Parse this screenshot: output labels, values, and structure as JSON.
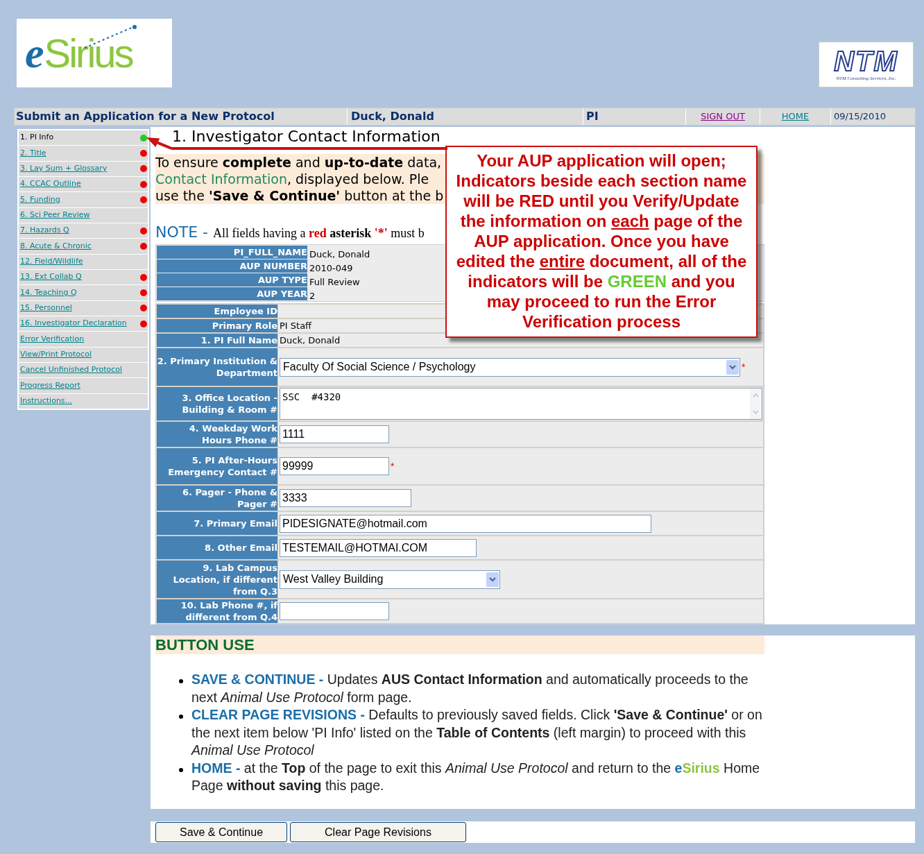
{
  "logo": {
    "letter": "e",
    "word": "Sirius"
  },
  "partner_logo": {
    "mark": "NTM",
    "caption": "NTM Consulting Services, Inc."
  },
  "top_bar": {
    "title": "Submit an Application for a New Protocol",
    "user": "Duck, Donald",
    "role": "PI",
    "sign_out": "SIGN OUT",
    "home": "HOME",
    "date": "09/15/2010"
  },
  "sidebar": {
    "items": [
      {
        "label": "1. PI Info",
        "selected": true,
        "color": "#22cc22"
      },
      {
        "label": "2. Title",
        "selected": false,
        "color": "#ee0000"
      },
      {
        "label": "3. Lay Sum + Glossary",
        "selected": false,
        "color": "#ee0000"
      },
      {
        "label": "4. CCAC Outline",
        "selected": false,
        "color": "#ee0000"
      },
      {
        "label": "5. Funding",
        "selected": false,
        "color": "#ee0000"
      },
      {
        "label": "6. Sci Peer Review",
        "selected": false
      },
      {
        "label": "7. Hazards Q",
        "selected": false,
        "color": "#ee0000"
      },
      {
        "label": "8. Acute & Chronic",
        "selected": false,
        "color": "#ee0000"
      },
      {
        "label": "12. Field/Wildlife",
        "selected": false
      },
      {
        "label": "13. Ext Collab Q",
        "selected": false,
        "color": "#ee0000"
      },
      {
        "label": "14. Teaching Q",
        "selected": false,
        "color": "#ee0000"
      },
      {
        "label": "15. Personnel",
        "selected": false,
        "color": "#ee0000"
      },
      {
        "label": "16. Investigator Declaration",
        "selected": false,
        "color": "#ee0000"
      },
      {
        "label": "Error Verification",
        "selected": false
      },
      {
        "label": "View/Print Protocol",
        "selected": false
      },
      {
        "label": "Cancel Unfinished Protocol",
        "selected": false
      },
      {
        "label": "Progress Report",
        "selected": false
      },
      {
        "label": "Instructions...",
        "selected": false
      }
    ]
  },
  "section_title": "1. Investigator Contact Information",
  "intro_lines": [
    [
      {
        "kind": "plain",
        "text": "To ensure "
      },
      {
        "kind": "bold",
        "text": "complete"
      },
      {
        "kind": "plain",
        "text": " and "
      },
      {
        "kind": "bold",
        "text": "up-to-date"
      },
      {
        "kind": "plain",
        "text": " data,"
      }
    ],
    [
      {
        "kind": "green",
        "text": "Contact Information"
      },
      {
        "kind": "plain",
        "text": ", displayed below. Ple"
      }
    ],
    [
      {
        "kind": "plain",
        "text": "use the "
      },
      {
        "kind": "bold",
        "text": "'Save & Continue'"
      },
      {
        "kind": "plain",
        "text": " button at the b"
      }
    ]
  ],
  "note": {
    "lead": "NOTE -",
    "parts": [
      {
        "kind": "plain",
        "text": "All fields having a "
      },
      {
        "kind": "red",
        "text": "red"
      },
      {
        "kind": "bold",
        "text": " asterisk "
      },
      {
        "kind": "red",
        "text": "'*'"
      },
      {
        "kind": "plain",
        "text": " must b"
      }
    ]
  },
  "summary_rows": [
    {
      "label": "PI_FULL_NAME",
      "value": "Duck, Donald"
    },
    {
      "label": "AUP NUMBER",
      "value": "2010-049"
    },
    {
      "label": "AUP TYPE",
      "value": "Full Review"
    },
    {
      "label": "AUP YEAR",
      "value": "2"
    }
  ],
  "form_rows": [
    {
      "kind": "text",
      "label": "Employee ID"
    },
    {
      "kind": "text",
      "label": "Primary Role",
      "value": "PI Staff"
    },
    {
      "kind": "text",
      "label": "1. PI Full Name",
      "value": "Duck, Donald"
    },
    {
      "kind": "select",
      "label": "2. Primary Institution & Department",
      "value": "Faculty Of Social Science / Psychology",
      "asterisk": "*"
    },
    {
      "kind": "textarea",
      "label": "3. Office Location - Building & Room #",
      "value": "SSC  #4320"
    },
    {
      "kind": "input",
      "label": "4. Weekday Work Hours Phone #",
      "value": "1111"
    },
    {
      "kind": "input",
      "label": "5. PI After-Hours Emergency Contact #",
      "value": "99999",
      "asterisk": "*"
    },
    {
      "kind": "input",
      "label": "6. Pager - Phone & Pager #",
      "value": "3333"
    },
    {
      "kind": "input",
      "label": "7. Primary Email",
      "value": "PIDESIGNATE@hotmail.com"
    },
    {
      "kind": "input",
      "label": "8. Other Email",
      "value": "TESTEMAIL@HOTMAI.COM"
    },
    {
      "kind": "select",
      "label": "9. Lab Campus Location, if different from Q.3",
      "value": "West Valley Building"
    },
    {
      "kind": "input",
      "label": "10. Lab Phone #, if different from Q.4"
    }
  ],
  "callout": [
    {
      "kind": "plain",
      "text": "Your AUP application will open; Indicators beside each section name will be RED until you Verify/Update the information on "
    },
    {
      "kind": "underline",
      "text": "each"
    },
    {
      "kind": "plain",
      "text": " page of the AUP application. Once you have edited the "
    },
    {
      "kind": "underline",
      "text": "entire"
    },
    {
      "kind": "plain",
      "text": " document, all of the indicators will be "
    },
    {
      "kind": "green",
      "text": "GREEN"
    },
    {
      "kind": "plain",
      "text": " and you may proceed to run the Error Verification process"
    }
  ],
  "button_use": {
    "title": "BUTTON USE",
    "items": [
      [
        {
          "kind": "lead",
          "text": "SAVE & CONTINUE -"
        },
        {
          "kind": "rich",
          "text": " Updates **AUS Contact Information** and automatically proceeds to the next *Animal Use Protocol* form page."
        }
      ],
      [
        {
          "kind": "lead",
          "text": "CLEAR PAGE REVISIONS -"
        },
        {
          "kind": "rich",
          "text": " Defaults to previously saved fields. Click **'Save & Continue'** or on the next item below 'PI Info' listed on the **Table of Contents** (left margin) to proceed with this *Animal Use Protocol*"
        }
      ],
      [
        {
          "kind": "lead",
          "text": "HOME -"
        },
        {
          "kind": "rich",
          "text": " at the **Top** of the page to exit this *Animal Use Protocol* and return to the "
        },
        {
          "kind": "brand-e",
          "text": "e"
        },
        {
          "kind": "brand-rest",
          "text": "Sirius"
        },
        {
          "kind": "rich",
          "text": " Home Page **without saving** this page."
        }
      ]
    ]
  },
  "buttons": [
    "Save & Continue",
    "Clear Page Revisions"
  ]
}
